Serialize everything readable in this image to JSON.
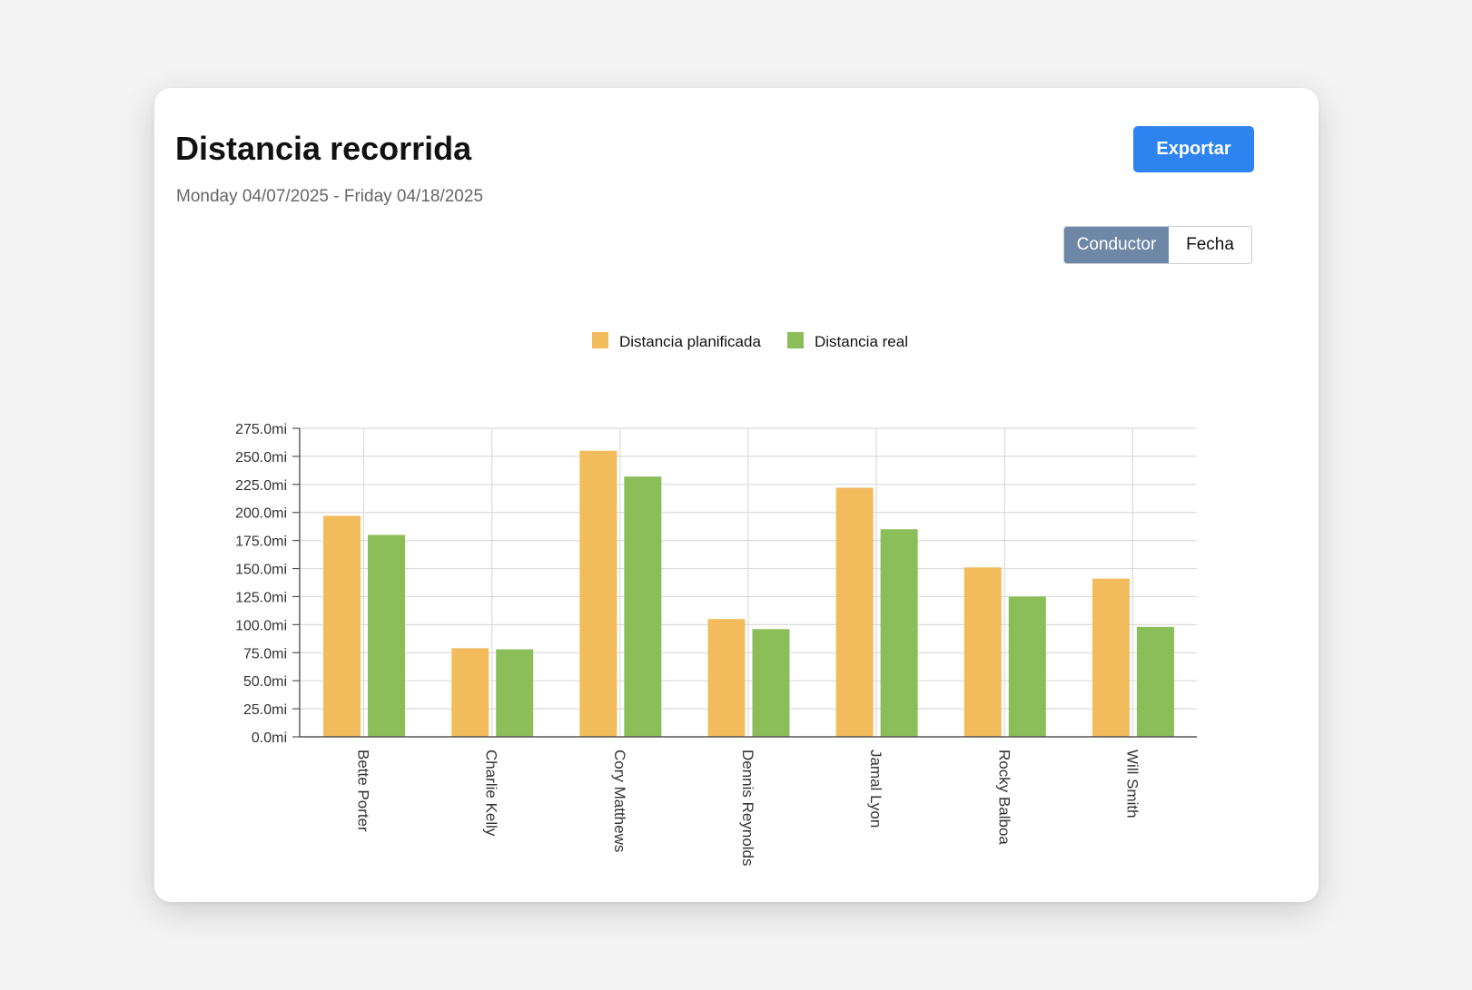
{
  "header": {
    "title": "Distancia recorrida",
    "date_range": "Monday 04/07/2025 - Friday 04/18/2025",
    "export_label": "Exportar"
  },
  "toggle": {
    "options": [
      "Conductor",
      "Fecha"
    ],
    "active": "Conductor"
  },
  "colors": {
    "accent": "#2d83ef",
    "toggle_active": "#6e87a6",
    "planned": "#f2bb5c",
    "actual": "#8bbd59"
  },
  "chart_data": {
    "type": "bar",
    "categories": [
      "Bette Porter",
      "Charlie Kelly",
      "Cory Matthews",
      "Dennis Reynolds",
      "Jamal Lyon",
      "Rocky Balboa",
      "Will Smith"
    ],
    "series": [
      {
        "name": "Distancia planificada",
        "values": [
          197,
          79,
          255,
          105,
          222,
          151,
          141
        ]
      },
      {
        "name": "Distancia real",
        "values": [
          180,
          78,
          232,
          96,
          185,
          125,
          98
        ]
      }
    ],
    "y_ticks": [
      "0.0mi",
      "25.0mi",
      "50.0mi",
      "75.0mi",
      "100.0mi",
      "125.0mi",
      "150.0mi",
      "175.0mi",
      "200.0mi",
      "225.0mi",
      "250.0mi",
      "275.0mi"
    ],
    "ylim": [
      0,
      275
    ],
    "grid": true,
    "legend_position": "top-center",
    "xlabel": "",
    "ylabel": ""
  }
}
